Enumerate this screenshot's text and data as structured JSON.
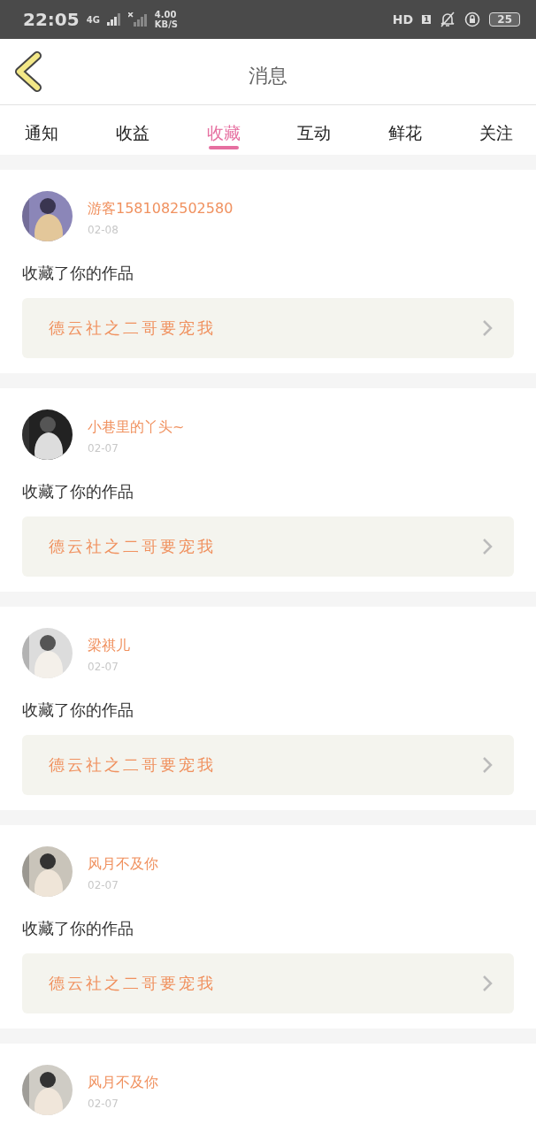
{
  "status_bar": {
    "time": "22:05",
    "network": "4G",
    "speed": "4.00",
    "speed_unit": "KB/S",
    "hd": "HD",
    "hd_sub": "1",
    "battery": "25"
  },
  "header": {
    "title": "消息"
  },
  "tabs": [
    {
      "label": "通知",
      "selected": false
    },
    {
      "label": "收益",
      "selected": false
    },
    {
      "label": "收藏",
      "selected": true
    },
    {
      "label": "互动",
      "selected": false
    },
    {
      "label": "鲜花",
      "selected": false
    },
    {
      "label": "关注",
      "selected": false
    }
  ],
  "messages": [
    {
      "user": "游客1581082502580",
      "date": "02-08",
      "action": "收藏了你的作品",
      "work": "德云社之二哥要宠我"
    },
    {
      "user": "小巷里的丫头~",
      "date": "02-07",
      "action": "收藏了你的作品",
      "work": "德云社之二哥要宠我"
    },
    {
      "user": "梁祺儿",
      "date": "02-07",
      "action": "收藏了你的作品",
      "work": "德云社之二哥要宠我"
    },
    {
      "user": "风月不及你",
      "date": "02-07",
      "action": "收藏了你的作品",
      "work": "德云社之二哥要宠我"
    },
    {
      "user": "风月不及你",
      "date": "02-07"
    }
  ]
}
